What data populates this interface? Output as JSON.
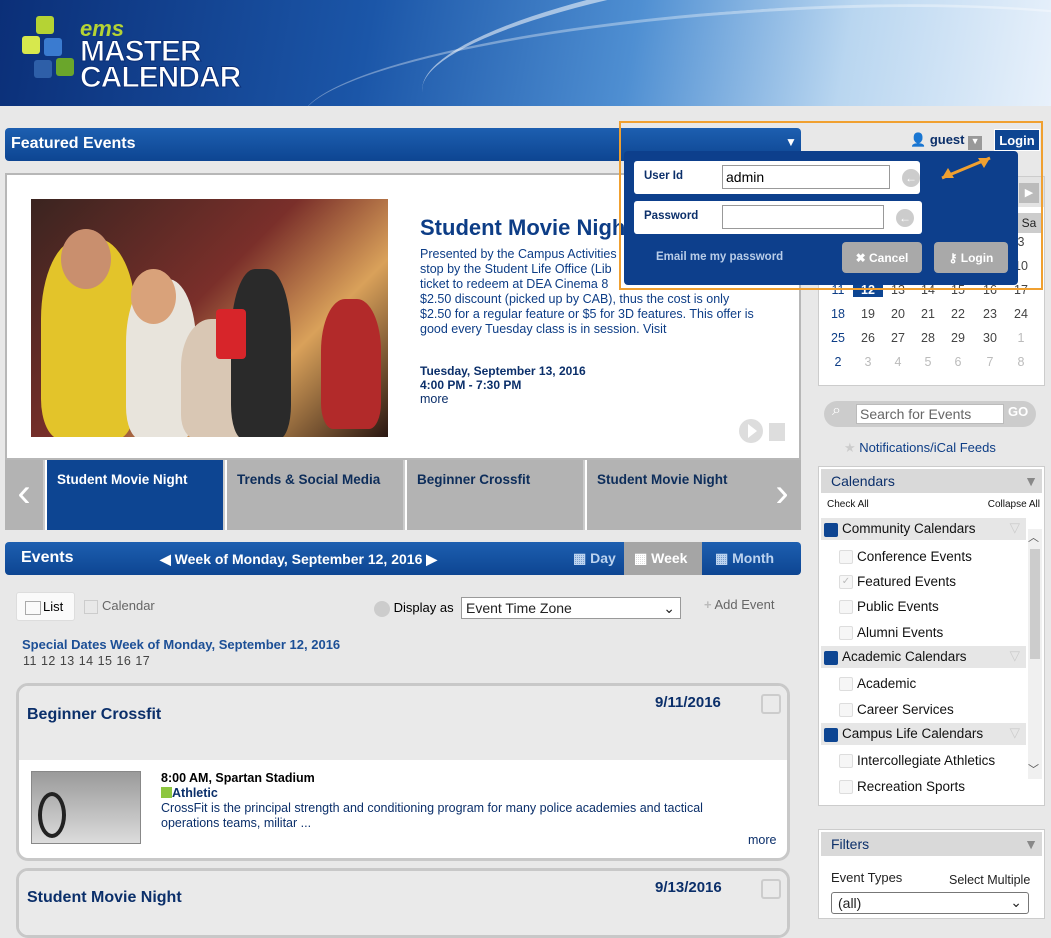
{
  "header": {
    "logo_small": "ems",
    "logo_line1": "MASTER",
    "logo_line2": "CALENDAR"
  },
  "featured": {
    "bar_title": "Featured Events",
    "title": "Student Movie Night",
    "description": "Presented by the Campus Activities ... stop by the Student Life Office (Lib... ticket to redeem at DEA Cinema 8 ... $2.50 discount (picked up by CAB), thus the cost is only $2.50 for a regular feature or $5 for 3D features. This offer is good every Tuesday class is in session. Visit",
    "desc_lines": [
      "Presented by the Campus Activities",
      "stop by the Student Life Office (Lib",
      "ticket to redeem at DEA Cinema 8",
      "$2.50 discount (picked up by CAB), thus the cost is only",
      "$2.50 for a regular feature or $5 for 3D features. This offer is",
      "good every Tuesday class is in session. Visit"
    ],
    "date": "Tuesday, September 13, 2016",
    "time": "4:00 PM - 7:30 PM",
    "more": "more"
  },
  "carousel": {
    "items": [
      "Student Movie Night",
      "Trends & Social Media",
      "Beginner Crossfit",
      "Student Movie Night"
    ],
    "active_index": 0
  },
  "events": {
    "title": "Events",
    "week_label": "Week of Monday, September 12, 2016",
    "views": [
      "Day",
      "Week",
      "Month"
    ],
    "active_view": "Week",
    "list_label": "List",
    "calendar_label": "Calendar",
    "display_as_label": "Display as",
    "timezone": "Event Time Zone",
    "add_event": "Add Event",
    "special_dates": "Special Dates Week of Monday, September 12, 2016",
    "special_days": "11 12 13 14 15 16 17",
    "cards": [
      {
        "title": "Beginner Crossfit",
        "date": "9/11/2016",
        "time_location": "8:00 AM, Spartan Stadium",
        "category": "Athletic",
        "category_color": "#8dc63f",
        "description": "CrossFit is the principal strength and conditioning program for many police academies and tactical operations teams, militar ...",
        "more": "more"
      },
      {
        "title": "Student Movie Night",
        "date": "9/13/2016"
      }
    ]
  },
  "user": {
    "name": "guest",
    "login_button": "Login"
  },
  "login_popup": {
    "user_id_label": "User Id",
    "user_id_value": "admin",
    "password_label": "Password",
    "password_value": "",
    "email_link": "Email me my password",
    "cancel": "Cancel",
    "login": "Login"
  },
  "mini_calendar": {
    "header_fragment": "Sa",
    "rows": [
      [
        "",
        "",
        "",
        "",
        "",
        "",
        "3"
      ],
      [
        "",
        "",
        "",
        "",
        "",
        "",
        "10"
      ],
      [
        "11",
        "12",
        "13",
        "14",
        "15",
        "16",
        "17"
      ],
      [
        "18",
        "19",
        "20",
        "21",
        "22",
        "23",
        "24"
      ],
      [
        "25",
        "26",
        "27",
        "28",
        "29",
        "30",
        "1"
      ],
      [
        "2",
        "3",
        "4",
        "5",
        "6",
        "7",
        "8"
      ]
    ],
    "today": "12"
  },
  "search": {
    "placeholder": "Search for Events",
    "go": "GO"
  },
  "notifications": "Notifications/iCal Feeds",
  "calendars": {
    "title": "Calendars",
    "check_all": "Check All",
    "collapse_all": "Collapse All",
    "groups": [
      {
        "name": "Community Calendars",
        "items": [
          "Conference Events",
          "Featured Events",
          "Public Events",
          "Alumni Events"
        ]
      },
      {
        "name": "Academic Calendars",
        "items": [
          "Academic",
          "Career Services"
        ]
      },
      {
        "name": "Campus Life Calendars",
        "items": [
          "Intercollegiate Athletics",
          "Recreation Sports"
        ]
      }
    ]
  },
  "filters": {
    "title": "Filters",
    "event_types": "Event Types",
    "select_multiple": "Select Multiple",
    "value": "(all)"
  },
  "colors": {
    "brand_blue": "#0d4592",
    "highlight_orange": "#f0a030",
    "accent_green": "#8dc63f"
  }
}
